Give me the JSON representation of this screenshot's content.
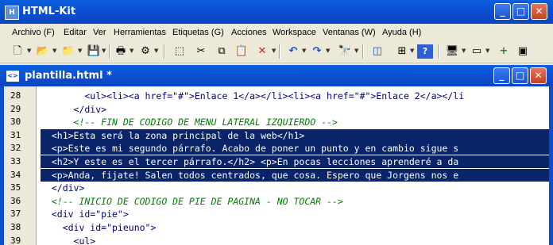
{
  "app": {
    "title": "HTML-Kit",
    "window_buttons": [
      "_",
      "□",
      "✕"
    ]
  },
  "menu": [
    {
      "label": "Archivo (F)"
    },
    {
      "label": "Editar"
    },
    {
      "label": "Ver"
    },
    {
      "label": "Herramientas"
    },
    {
      "label": "Etiquetas (G)"
    },
    {
      "label": "Acciones"
    },
    {
      "label": "Workspace"
    },
    {
      "label": "Ventanas (W)"
    },
    {
      "label": "Ayuda (H)"
    }
  ],
  "toolbar": {
    "icons": [
      "new-file-icon",
      "open-folder-icon",
      "open-recent-icon",
      "save-icon",
      "print-icon",
      "properties-icon",
      "select-icon",
      "cut-icon",
      "copy-icon",
      "paste-icon",
      "delete-icon",
      "undo-icon",
      "redo-icon",
      "find-icon",
      "split-view-icon",
      "tree-icon",
      "help-icon",
      "preview-icon",
      "view-icon",
      "add-icon",
      "panel-icon"
    ]
  },
  "document": {
    "title": "plantilla.html *"
  },
  "editor": {
    "lines": [
      {
        "num": "28",
        "text": "        <ul><li><a href=\"#\">Enlace 1</a></li><li><a href=\"#\">Enlace 2</a></li",
        "kind": "code",
        "selected": false
      },
      {
        "num": "29",
        "text": "      </div>",
        "kind": "code",
        "selected": false
      },
      {
        "num": "30",
        "text": "      <!-- FIN DE CODIGO DE MENU LATERAL IZQUIERDO -->",
        "kind": "comment",
        "selected": false
      },
      {
        "num": "31",
        "text": "  <h1>Esta será la zona principal de la web</h1>",
        "kind": "code",
        "selected": true
      },
      {
        "num": "32",
        "text": "  <p>Este es mi segundo párrafo. Acabo de poner un punto y en cambio sigue s",
        "kind": "code",
        "selected": true
      },
      {
        "num": "33",
        "text": "  <h2>Y este es el tercer párrafo.</h2> <p>En pocas lecciones aprenderé a da",
        "kind": "code",
        "selected": true
      },
      {
        "num": "34",
        "text": "  <p>Anda, fijate! Salen todos centrados, que cosa. Espero que Jorgens nos e",
        "kind": "code",
        "selected": true
      },
      {
        "num": "35",
        "text": "  </div>",
        "kind": "code",
        "selected": false
      },
      {
        "num": "36",
        "text": "  <!-- INICIO DE CODIGO DE PIE DE PAGINA - NO TOCAR -->",
        "kind": "comment",
        "selected": false
      },
      {
        "num": "37",
        "text": "  <div id=\"pie\">",
        "kind": "code",
        "selected": false
      },
      {
        "num": "38",
        "text": "    <div id=\"pieuno\">",
        "kind": "code",
        "selected": false
      },
      {
        "num": "39",
        "text": "      <ul>",
        "kind": "code",
        "selected": false
      }
    ]
  }
}
